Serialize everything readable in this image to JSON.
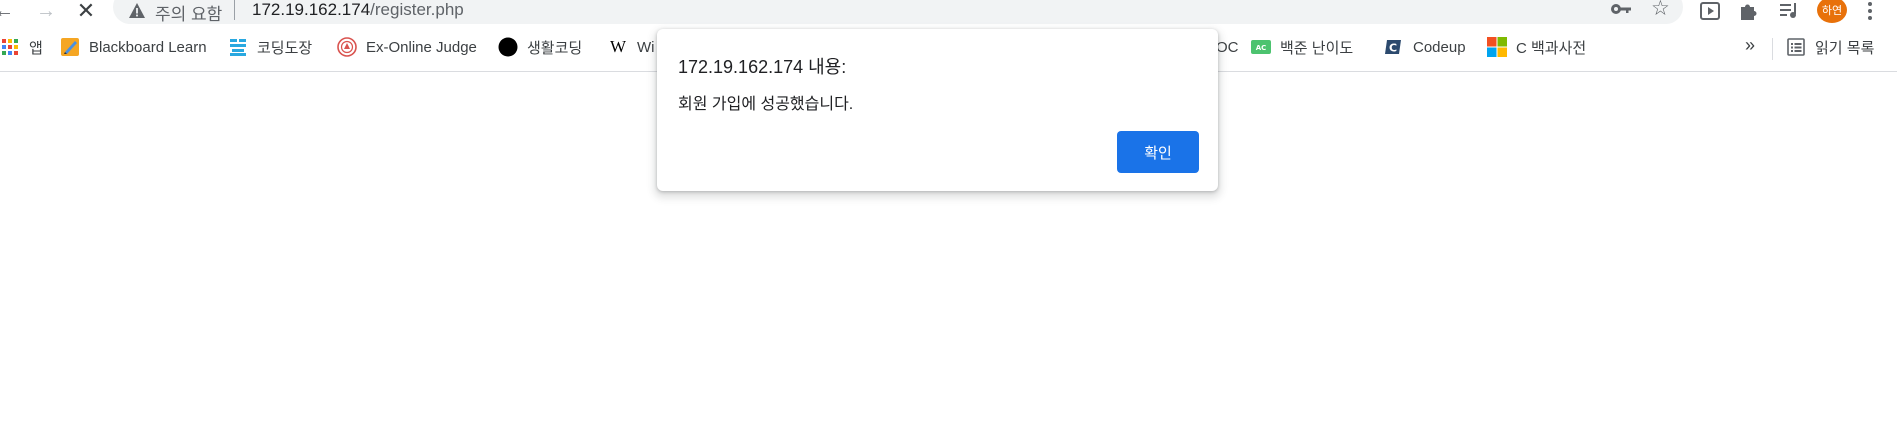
{
  "omnibox": {
    "security_label": "주의 요함",
    "url_host": "172.19.162.174",
    "url_path": "/register.php"
  },
  "profile": {
    "initials": "하연"
  },
  "bookmarks": {
    "items": [
      {
        "label": "앱",
        "icon": "apps-grid-icon"
      },
      {
        "label": "Blackboard Learn",
        "icon": "blackboard-icon"
      },
      {
        "label": "코딩도장",
        "icon": "codingdojang-icon"
      },
      {
        "label": "Ex-Online Judge",
        "icon": "ex-online-judge-icon"
      },
      {
        "label": "생활코딩",
        "icon": "opentutorials-icon"
      },
      {
        "label": "Wi",
        "icon": "wikipedia-icon"
      },
      {
        "label": "OC",
        "icon": ""
      },
      {
        "label": "백준 난이도",
        "icon": "solvedac-icon"
      },
      {
        "label": "Codeup",
        "icon": "codeup-icon"
      },
      {
        "label": "C 백과사전",
        "icon": "microsoft-icon"
      }
    ],
    "overflow": "»",
    "reading_list_label": "읽기 목록"
  },
  "dialog": {
    "title": "172.19.162.174 내용:",
    "message": "회원 가입에 성공했습니다.",
    "ok_label": "확인"
  },
  "colors": {
    "accent": "#1a73e8",
    "avatar": "#e8710a",
    "omnibox_bg": "#f1f3f4"
  }
}
